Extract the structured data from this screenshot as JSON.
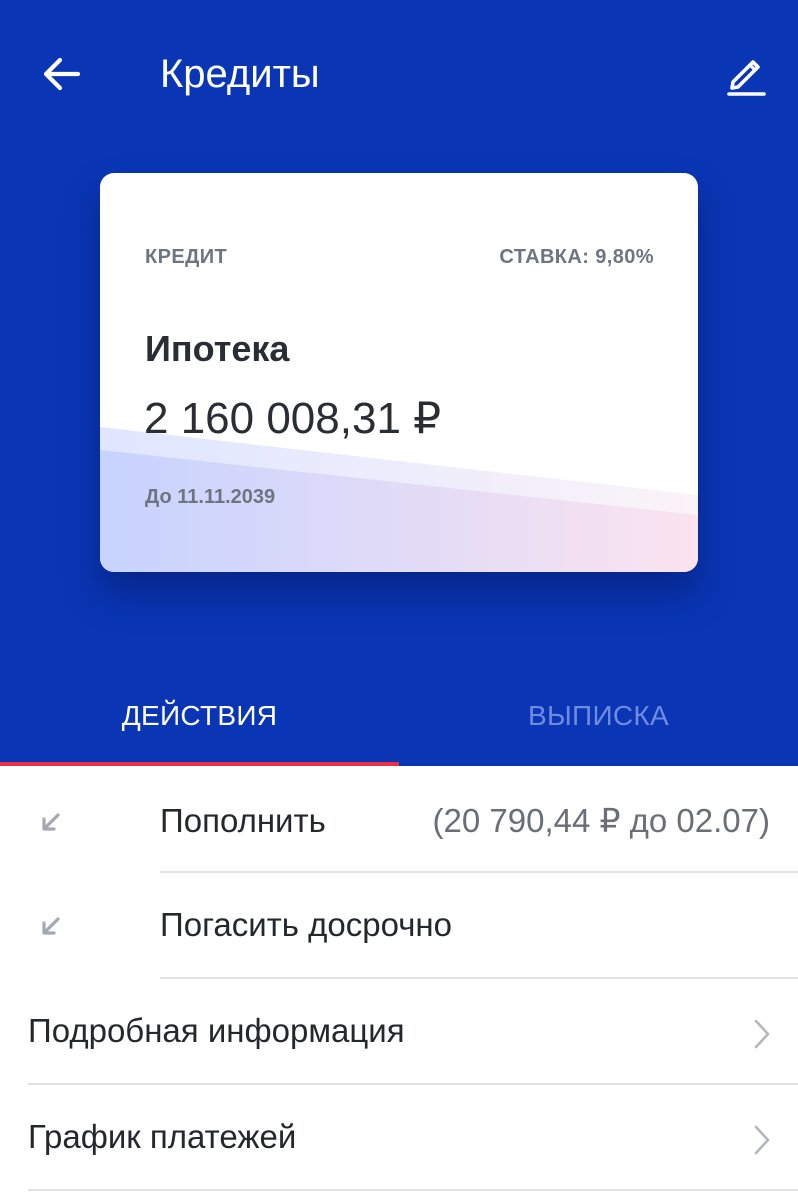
{
  "header": {
    "title": "Кредиты",
    "back_icon": "arrow-left-icon",
    "edit_icon": "pencil-icon",
    "background": "#0a36b5"
  },
  "card": {
    "type_label": "КРЕДИТ",
    "rate_label": "СТАВКА: 9,80%",
    "name": "Ипотека",
    "amount": "2 160 008,31 ₽",
    "due_label": "До 11.11.2039"
  },
  "tabs": [
    {
      "label": "ДЕЙСТВИЯ",
      "active": true
    },
    {
      "label": "ВЫПИСКА",
      "active": false
    }
  ],
  "tab_indicator_color": "#e8304a",
  "actions": [
    {
      "label": "Пополнить",
      "value": "(20 790,44 ₽ до 02.07)",
      "icon": "arrow-down-left-icon"
    },
    {
      "label": "Погасить досрочно",
      "icon": "arrow-down-left-icon"
    }
  ],
  "links": [
    {
      "label": "Подробная информация",
      "icon": "chevron-right-icon"
    },
    {
      "label": "График платежей",
      "icon": "chevron-right-icon"
    }
  ]
}
